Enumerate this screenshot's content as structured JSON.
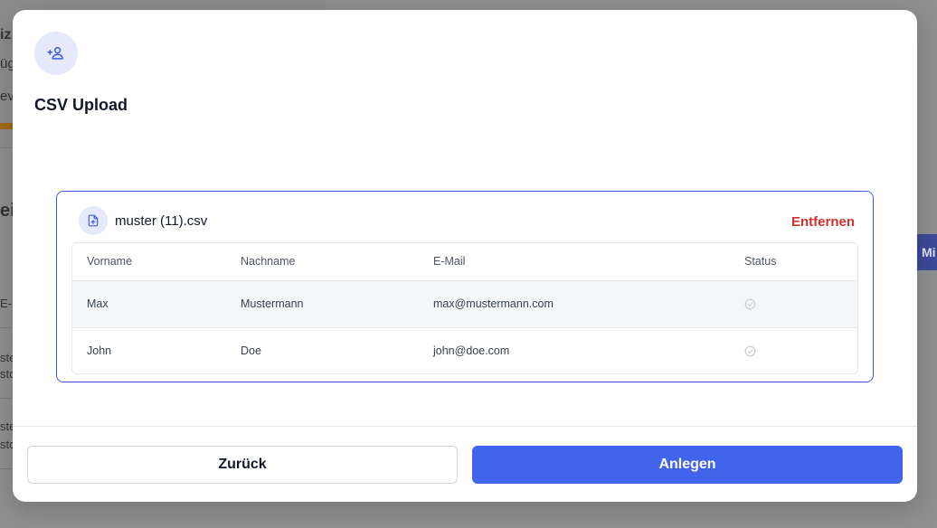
{
  "background": {
    "texts": [
      "iz",
      "üg",
      "ev",
      "ei",
      "E-M",
      "ste",
      "sto",
      "ste",
      "sto"
    ],
    "button_label": "Mi"
  },
  "modal": {
    "header_icon": "user-plus-icon",
    "title": "CSV Upload",
    "file": {
      "icon": "file-upload-icon",
      "name": "muster (11).csv",
      "remove_label": "Entfernen"
    },
    "table": {
      "headers": [
        "Vorname",
        "Nachname",
        "E-Mail",
        "Status"
      ],
      "rows": [
        {
          "vorname": "Max",
          "nachname": "Mustermann",
          "email": "max@mustermann.com",
          "status_icon": "check-circle-icon"
        },
        {
          "vorname": "John",
          "nachname": "Doe",
          "email": "john@doe.com",
          "status_icon": "check-circle-icon"
        }
      ]
    },
    "buttons": {
      "back_label": "Zurück",
      "create_label": "Anlegen"
    },
    "colors": {
      "accent": "#4263eb",
      "danger": "#d0312d",
      "icon_bg": "#e6e9fb"
    }
  }
}
